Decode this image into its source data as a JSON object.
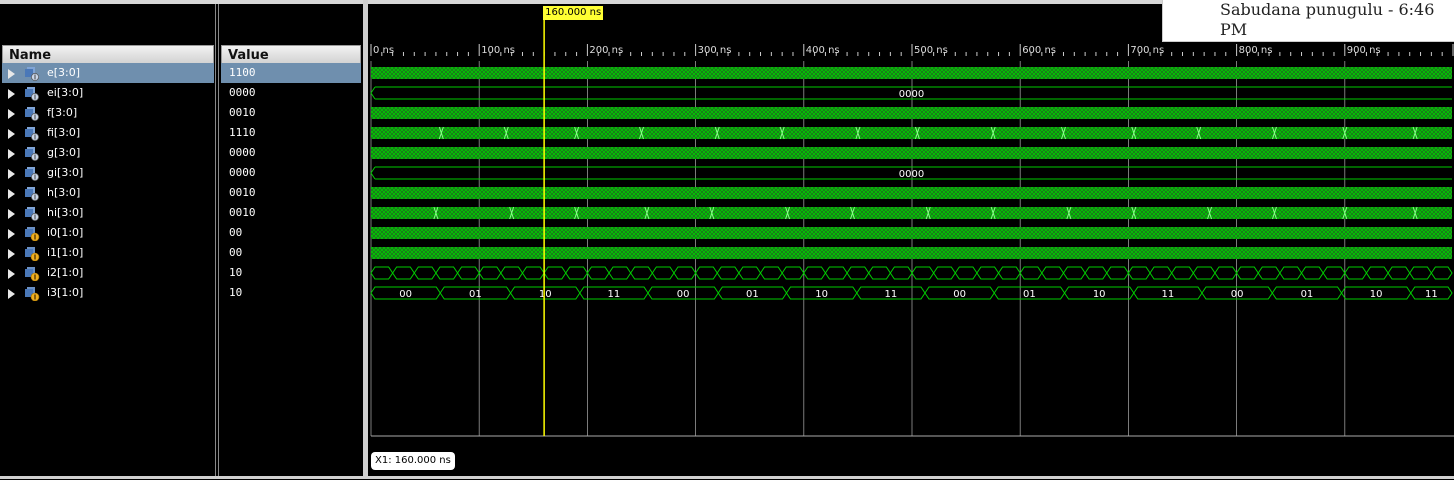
{
  "columns": {
    "name": "Name",
    "value": "Value"
  },
  "signals": [
    {
      "name": "e[3:0]",
      "value": "1100",
      "selected": true,
      "icon": "bus-signal-icon"
    },
    {
      "name": "ei[3:0]",
      "value": "0000",
      "icon": "bus-signal-icon"
    },
    {
      "name": "f[3:0]",
      "value": "0010",
      "icon": "bus-signal-icon"
    },
    {
      "name": "fi[3:0]",
      "value": "1110",
      "icon": "bus-signal-icon"
    },
    {
      "name": "g[3:0]",
      "value": "0000",
      "icon": "bus-signal-icon"
    },
    {
      "name": "gi[3:0]",
      "value": "0000",
      "icon": "bus-signal-icon"
    },
    {
      "name": "h[3:0]",
      "value": "0010",
      "icon": "bus-signal-icon"
    },
    {
      "name": "hi[3:0]",
      "value": "0010",
      "icon": "bus-signal-icon"
    },
    {
      "name": "i0[1:0]",
      "value": "00",
      "icon": "input-bus-icon"
    },
    {
      "name": "i1[1:0]",
      "value": "00",
      "icon": "input-bus-icon"
    },
    {
      "name": "i2[1:0]",
      "value": "10",
      "icon": "input-bus-icon"
    },
    {
      "name": "i3[1:0]",
      "value": "10",
      "icon": "input-bus-icon"
    }
  ],
  "time_axis": {
    "labels": [
      "0 ns",
      "100 ns",
      "200 ns",
      "300 ns",
      "400 ns",
      "500 ns",
      "600 ns",
      "700 ns",
      "800 ns",
      "900 ns"
    ],
    "max_ns": 1000,
    "minor_tick_ns": 10
  },
  "cursor": {
    "time_ns": 160,
    "label": "160.000 ns",
    "readout": "X1: 160.000 ns",
    "color": "#ffff00"
  },
  "waveforms": [
    {
      "kind": "dense"
    },
    {
      "kind": "constant",
      "label": "0000"
    },
    {
      "kind": "dense"
    },
    {
      "kind": "dense_marked",
      "marks_ns": [
        65,
        125,
        190,
        250,
        320,
        380,
        450,
        505,
        575,
        640,
        705,
        765,
        835,
        900,
        965,
        1020
      ]
    },
    {
      "kind": "dense"
    },
    {
      "kind": "constant",
      "label": "0000"
    },
    {
      "kind": "dense"
    },
    {
      "kind": "dense_marked",
      "marks_ns": [
        60,
        130,
        190,
        255,
        315,
        385,
        445,
        515,
        575,
        645,
        705,
        775,
        835,
        900,
        965,
        1020
      ]
    },
    {
      "kind": "dense"
    },
    {
      "kind": "dense"
    },
    {
      "kind": "periodic",
      "period_ns": 20
    },
    {
      "kind": "labeled_segments",
      "segments": [
        {
          "start": 0,
          "end": 64,
          "label": "00"
        },
        {
          "start": 64,
          "end": 129,
          "label": "01"
        },
        {
          "start": 129,
          "end": 193,
          "label": "10"
        },
        {
          "start": 193,
          "end": 256,
          "label": "11"
        },
        {
          "start": 256,
          "end": 321,
          "label": "00"
        },
        {
          "start": 321,
          "end": 384,
          "label": "01"
        },
        {
          "start": 384,
          "end": 449,
          "label": "10"
        },
        {
          "start": 449,
          "end": 512,
          "label": "11"
        },
        {
          "start": 512,
          "end": 576,
          "label": "00"
        },
        {
          "start": 576,
          "end": 641,
          "label": "01"
        },
        {
          "start": 641,
          "end": 705,
          "label": "10"
        },
        {
          "start": 705,
          "end": 768,
          "label": "11"
        },
        {
          "start": 768,
          "end": 833,
          "label": "00"
        },
        {
          "start": 833,
          "end": 897,
          "label": "01"
        },
        {
          "start": 897,
          "end": 961,
          "label": "10"
        },
        {
          "start": 961,
          "end": 1020,
          "label": "11"
        }
      ]
    }
  ],
  "colors": {
    "wave": "#00cc00",
    "wave_fill": "#1f6f1f",
    "grid": "#9a9a9a",
    "background": "#000000",
    "selected_row": "#6f8fae"
  },
  "notification": {
    "text": "Sabudana punugulu - 6:46 PM"
  }
}
